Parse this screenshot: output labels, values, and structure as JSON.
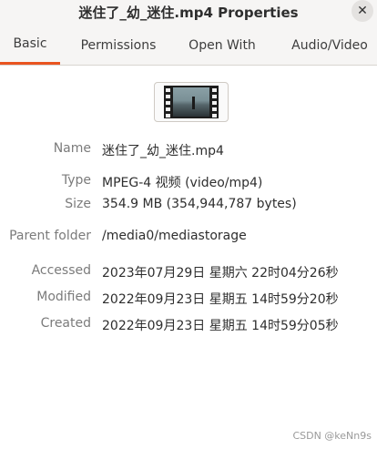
{
  "window": {
    "title": "迷住了_幼_迷住.mp4 Properties"
  },
  "tabs": [
    {
      "label": "Basic"
    },
    {
      "label": "Permissions"
    },
    {
      "label": "Open With"
    },
    {
      "label": "Audio/Video"
    }
  ],
  "properties": {
    "name": {
      "label": "Name",
      "value": "迷住了_幼_迷住.mp4"
    },
    "type": {
      "label": "Type",
      "value": "MPEG-4 视频 (video/mp4)"
    },
    "size": {
      "label": "Size",
      "value": "354.9 MB (354,944,787 bytes)"
    },
    "parent": {
      "label": "Parent folder",
      "value": "/media0/mediastorage"
    },
    "accessed": {
      "label": "Accessed",
      "value": "2023年07月29日 星期六 22时04分26秒"
    },
    "modified": {
      "label": "Modified",
      "value": "2022年09月23日 星期五 14时59分20秒"
    },
    "created": {
      "label": "Created",
      "value": "2022年09月23日 星期五 14时59分05秒"
    }
  },
  "watermark": "CSDN @keNn9s"
}
